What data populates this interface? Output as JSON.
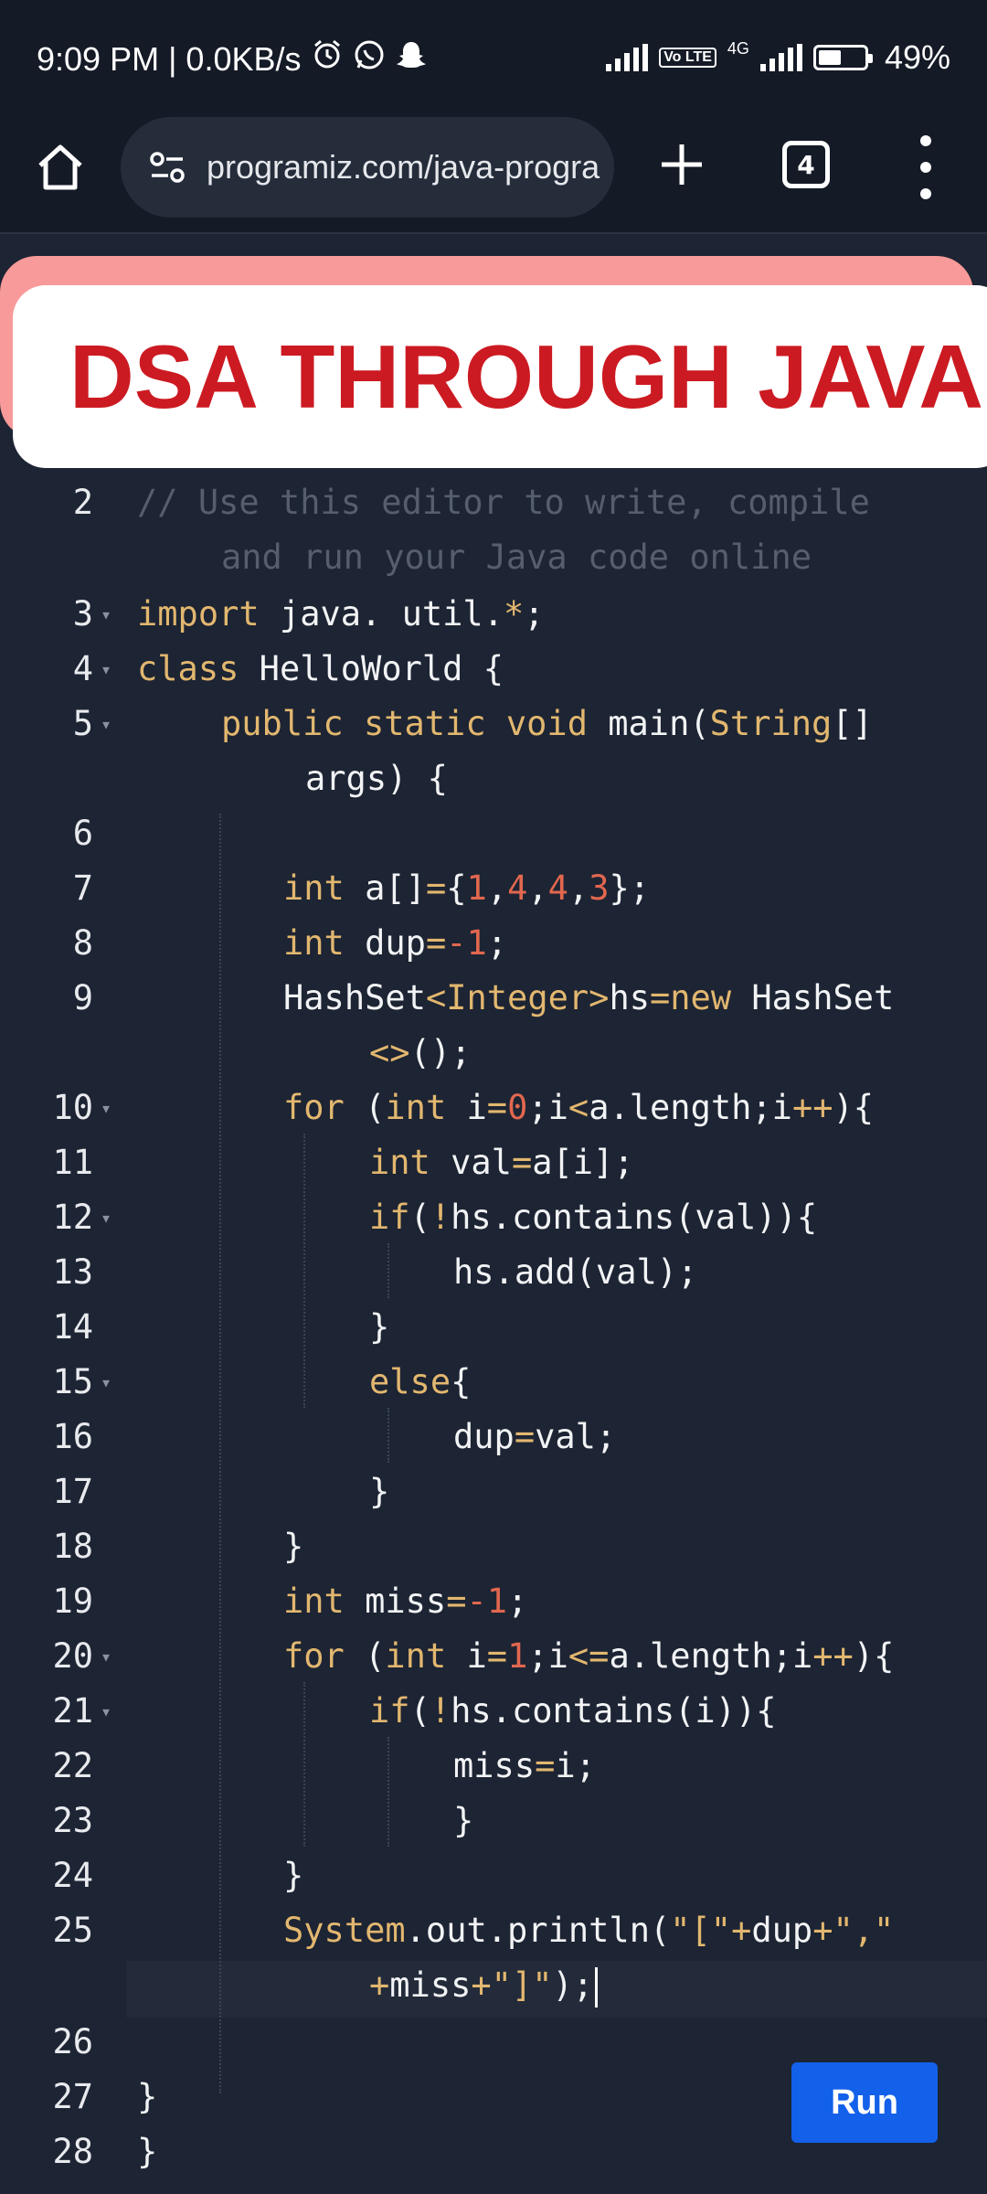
{
  "status": {
    "time": "9:09 PM | 0.0KB/s",
    "network": "4G",
    "volte": "Vo LTE",
    "battery": "49%"
  },
  "browser": {
    "url": "programiz.com/java-progra",
    "tab_count": "4"
  },
  "banner": {
    "title": "DSA THROUGH JAVA"
  },
  "editor": {
    "run_label": "Run",
    "line_numbers": [
      "2",
      "3",
      "4",
      "5",
      "6",
      "7",
      "8",
      "9",
      "10",
      "11",
      "12",
      "13",
      "14",
      "15",
      "16",
      "17",
      "18",
      "19",
      "20",
      "21",
      "22",
      "23",
      "24",
      "25",
      "26",
      "27",
      "28"
    ]
  },
  "colors": {
    "background": "#1d2433",
    "keyword": "#e2b76f",
    "number": "#e2674f",
    "comment": "#565e6e",
    "run_button": "#1360ea",
    "banner_text": "#cc1a22"
  }
}
